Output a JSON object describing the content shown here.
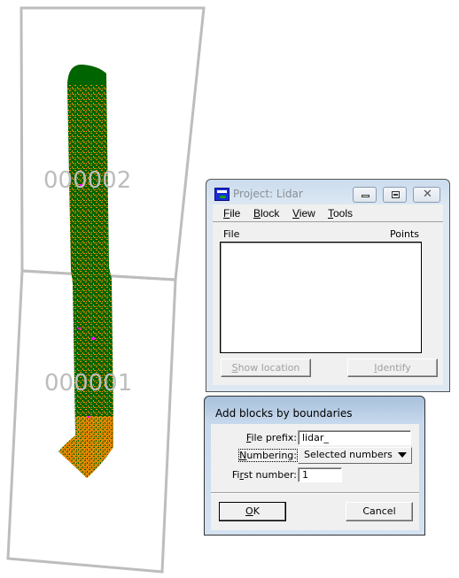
{
  "map": {
    "blocks": [
      {
        "label": "000002"
      },
      {
        "label": "000001"
      }
    ],
    "colors": {
      "boundary": "#bdbdbd",
      "vegetation": "#006400",
      "ground": "#ff8c00",
      "other": "#ff00ff"
    }
  },
  "project_window": {
    "title": "Project: Lidar",
    "menu": [
      {
        "label": "File",
        "mnemonic": "F",
        "rest": "ile"
      },
      {
        "label": "Block",
        "mnemonic": "B",
        "rest": "lock"
      },
      {
        "label": "View",
        "mnemonic": "V",
        "rest": "iew"
      },
      {
        "label": "Tools",
        "mnemonic": "T",
        "rest": "ools"
      }
    ],
    "list": {
      "columns": [
        "File",
        "Points"
      ],
      "rows": []
    },
    "buttons": {
      "show_location": {
        "mnemonic": "S",
        "rest": "how location",
        "enabled": false
      },
      "identify": {
        "mnemonic": "I",
        "rest": "dentify",
        "enabled": false
      }
    }
  },
  "add_blocks_dialog": {
    "title": "Add blocks by boundaries",
    "fields": {
      "file_prefix": {
        "label_mn": "F",
        "label_rest": "ile prefix:",
        "value": "lidar_"
      },
      "numbering": {
        "label_mn": "N",
        "label_rest": "umbering:",
        "value": "Selected numbers"
      },
      "first_number": {
        "label_pre": "Fi",
        "label_mn": "r",
        "label_rest": "st number:",
        "value": "1"
      }
    },
    "buttons": {
      "ok": {
        "mnemonic": "O",
        "rest": "K"
      },
      "cancel": {
        "label": "Cancel"
      }
    }
  }
}
